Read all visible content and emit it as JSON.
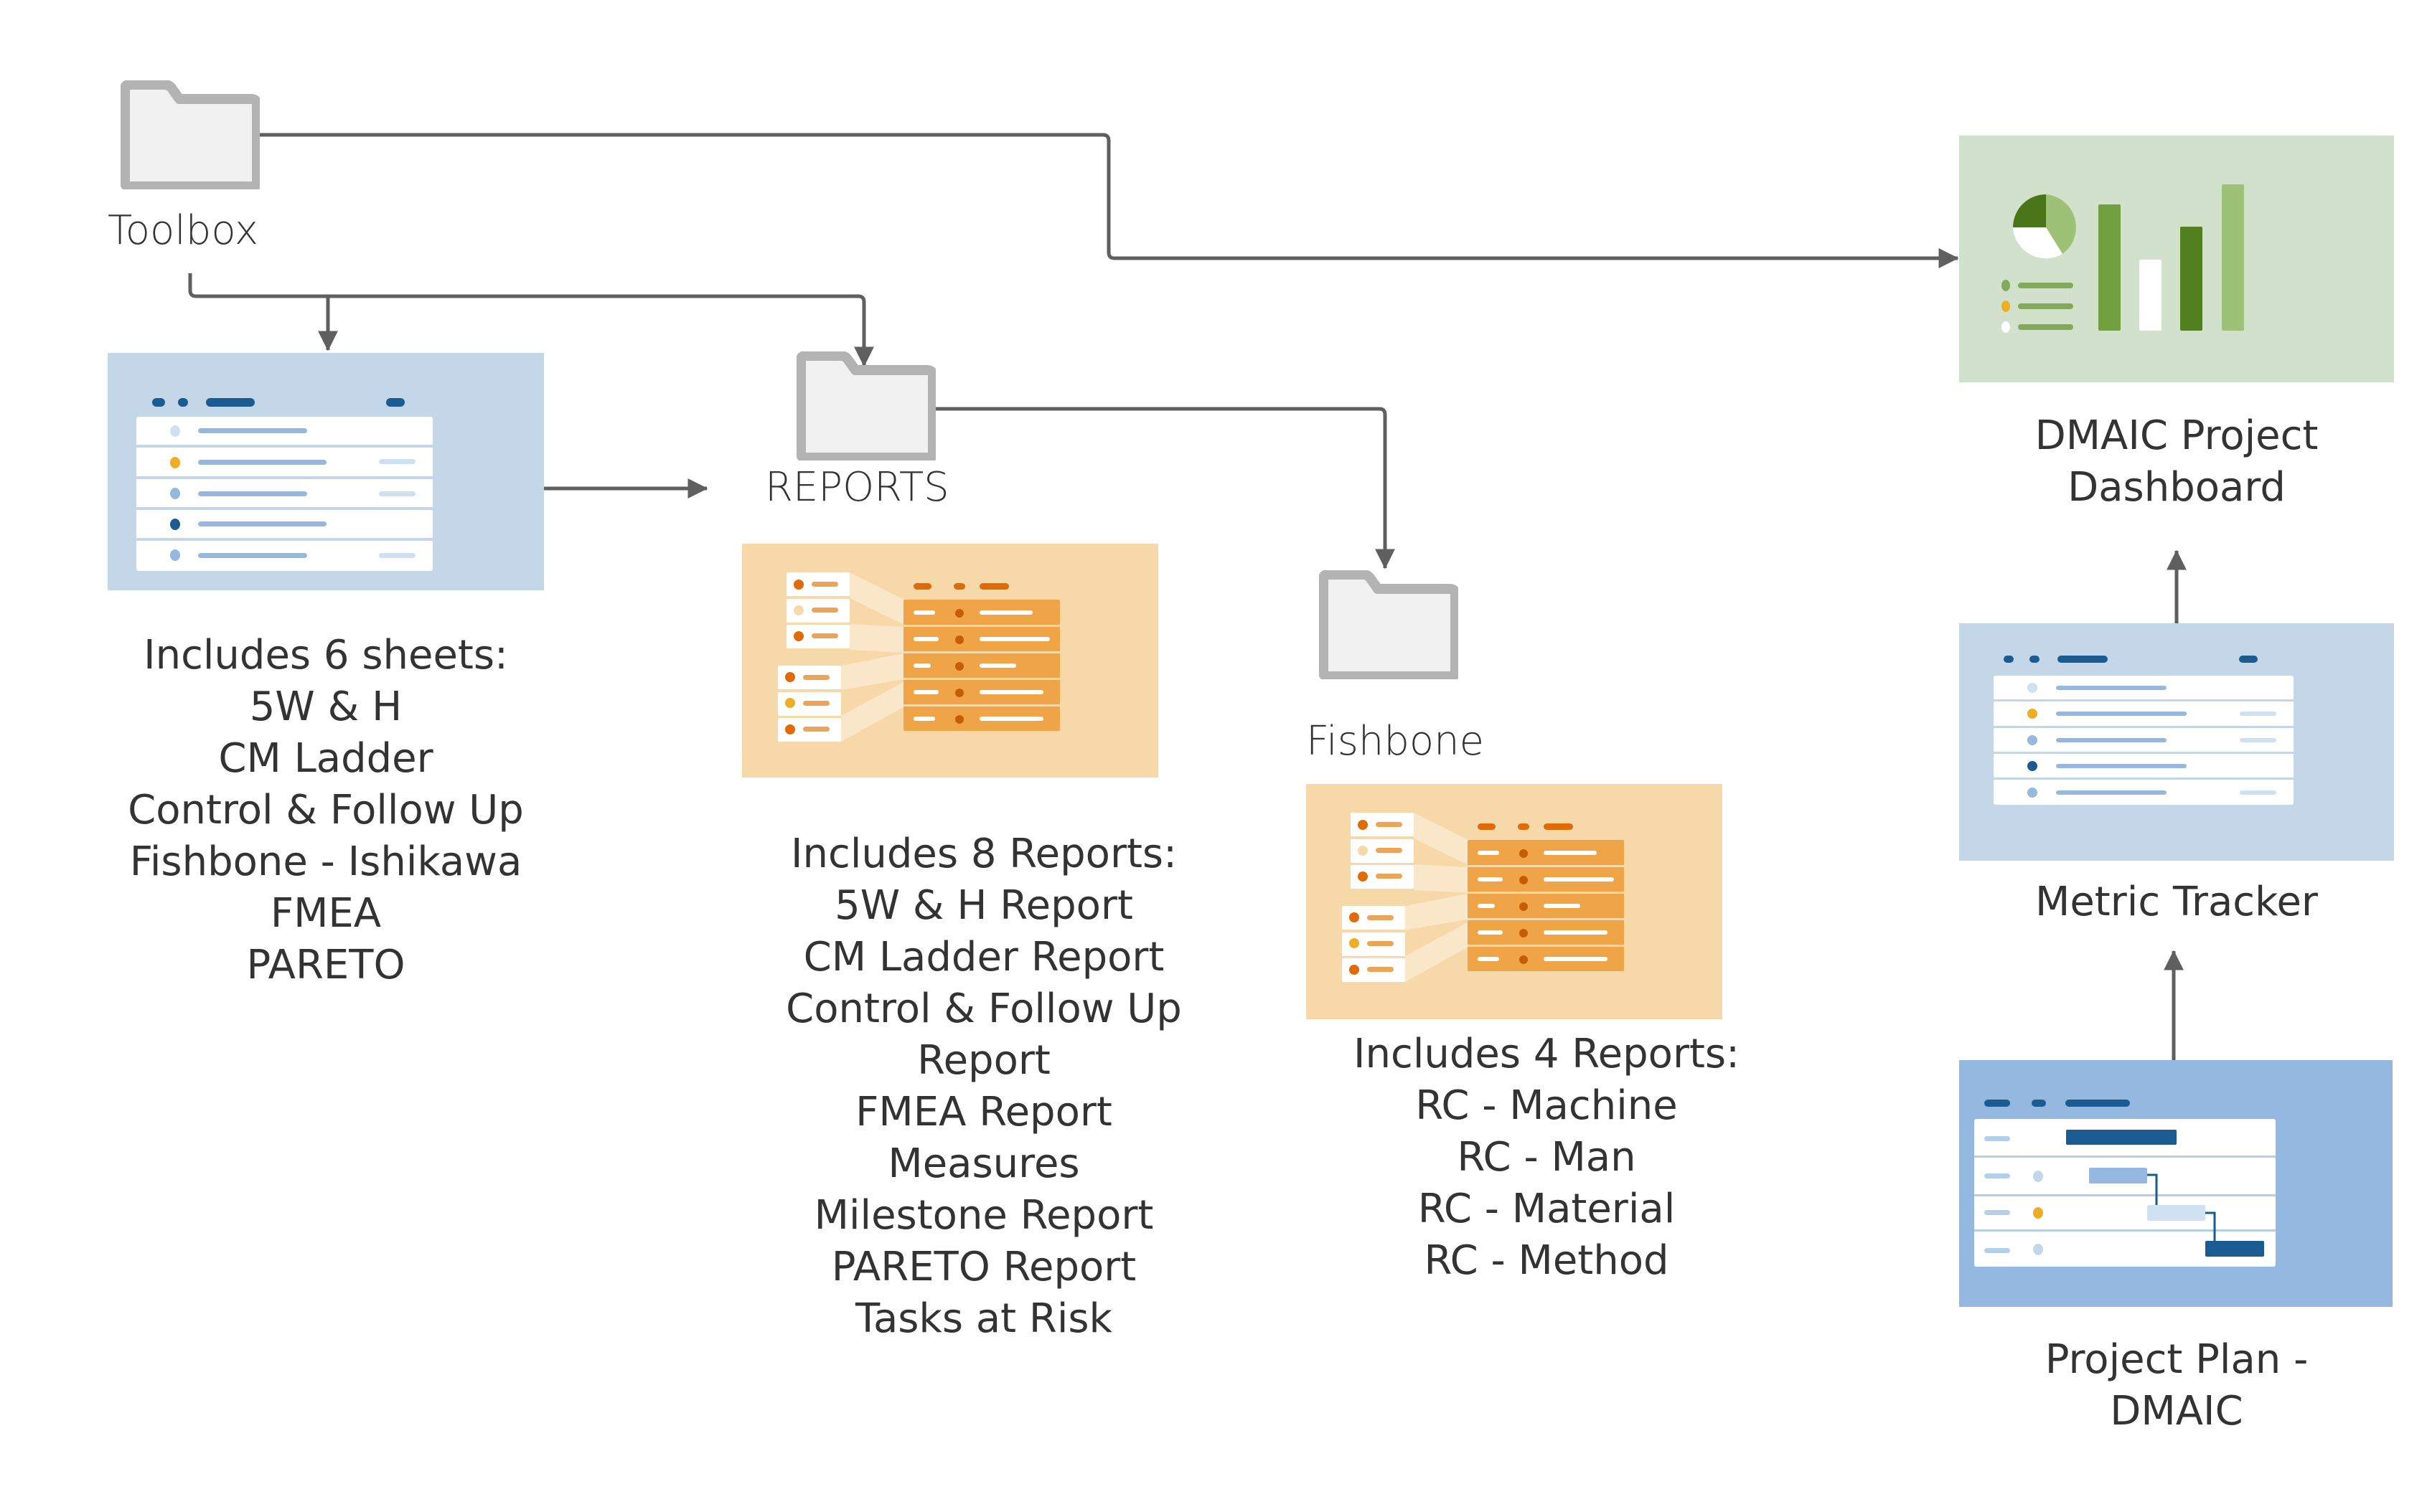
{
  "colors": {
    "connector": "#5f5f5f",
    "folder_border": "#b3b3b3",
    "folder_fill": "#f1f1f1",
    "sheet_bg": "#c3d7e8",
    "sheet_dark": "#1a5b92",
    "sheet_mid": "#94b8de",
    "sheet_light": "#cfe0f2",
    "accent_yellow": "#edae25",
    "report_bg": "#f7d8a9",
    "report_table": "#f0a448",
    "report_dark": "#df6a06",
    "report_dot": "#c65c03",
    "report_pale": "#fae6c8",
    "dashboard_bg": "#d2e1cb",
    "green_dark": "#4a7418",
    "green_mid": "#729f40",
    "green_deep": "#527f20",
    "green_light": "#9dc277",
    "green_line": "#82a95c",
    "plan_bg": "#94b8e0"
  },
  "nodes": {
    "toolbox": {
      "label": "Toolbox",
      "icon": "folder-icon"
    },
    "sheets_card": {
      "icon": "sheet-icon",
      "heading": "Includes 6 sheets:",
      "items": [
        "5W & H",
        "CM Ladder",
        "Control & Follow Up",
        "Fishbone - Ishikawa",
        "FMEA",
        "PARETO"
      ]
    },
    "reports": {
      "label": "REPORTS",
      "icon": "folder-icon",
      "illustration": "report-icon",
      "heading": "Includes 8 Reports:",
      "items": [
        "5W & H Report",
        "CM Ladder Report",
        "Control & Follow Up",
        "Report",
        "FMEA Report",
        "Measures",
        "Milestone Report",
        "PARETO Report",
        "Tasks at Risk"
      ]
    },
    "fishbone": {
      "label": "Fishbone",
      "icon": "folder-icon",
      "illustration": "report-icon",
      "heading": "Includes 4 Reports:",
      "items": [
        "RC - Machine",
        "RC - Man",
        "RC - Material",
        "RC - Method"
      ]
    },
    "dashboard": {
      "label_line1": "DMAIC Project",
      "label_line2": "Dashboard",
      "icon": "dashboard-icon"
    },
    "metric_tracker": {
      "label": "Metric Tracker",
      "icon": "sheet-icon"
    },
    "project_plan": {
      "label_line1": "Project Plan -",
      "label_line2": "DMAIC",
      "icon": "gantt-icon"
    }
  },
  "edges": [
    {
      "from": "toolbox",
      "to": "dashboard"
    },
    {
      "from": "toolbox",
      "to": "sheets_card"
    },
    {
      "from": "toolbox",
      "to": "reports"
    },
    {
      "from": "sheets_card",
      "to": "reports"
    },
    {
      "from": "reports",
      "to": "fishbone"
    },
    {
      "from": "metric_tracker",
      "to": "dashboard"
    },
    {
      "from": "project_plan",
      "to": "metric_tracker"
    }
  ]
}
